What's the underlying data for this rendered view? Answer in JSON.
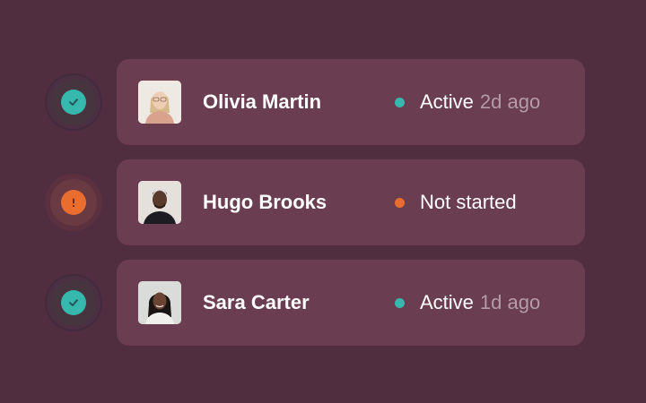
{
  "colors": {
    "background": "#512d40",
    "card": "#6a3d51",
    "active": "#37b8ad",
    "warning": "#e86d2e",
    "muted_text": "#b59aa8"
  },
  "people": [
    {
      "name": "Olivia Martin",
      "status": "Active",
      "time": "2d ago",
      "state": "ok",
      "badge_icon": "check-circle-icon"
    },
    {
      "name": "Hugo Brooks",
      "status": "Not started",
      "time": "",
      "state": "warn",
      "badge_icon": "exclamation-circle-icon"
    },
    {
      "name": "Sara Carter",
      "status": "Active",
      "time": "1d ago",
      "state": "ok",
      "badge_icon": "check-circle-icon"
    }
  ]
}
